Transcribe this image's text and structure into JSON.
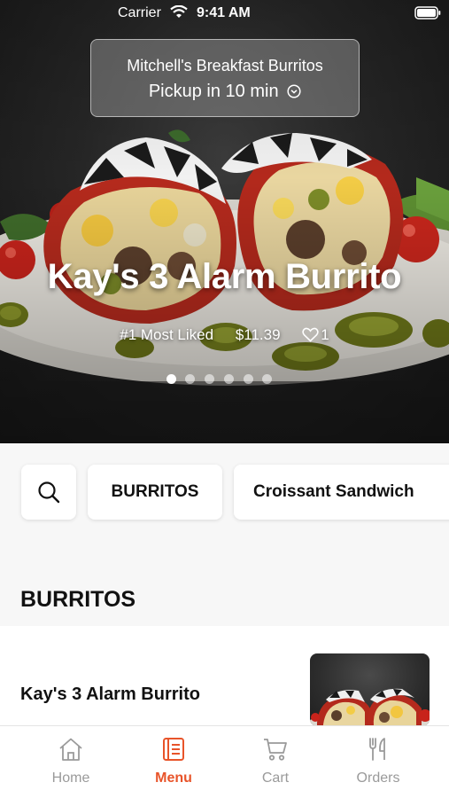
{
  "status_bar": {
    "carrier": "Carrier",
    "time": "9:41 AM"
  },
  "pickup": {
    "restaurant": "Mitchell's Breakfast Burritos",
    "time_label": "Pickup in 10 min"
  },
  "hero": {
    "title": "Kay's 3 Alarm Burrito",
    "rank": "#1 Most Liked",
    "price": "$11.39",
    "likes": "1",
    "carousel": {
      "count": 6,
      "active_index": 0
    }
  },
  "categories": {
    "search_icon": "search-icon",
    "items": [
      "BURRITOS",
      "Croissant Sandwich"
    ]
  },
  "section": {
    "title": "BURRITOS"
  },
  "menu_items": [
    {
      "name": "Kay's 3 Alarm Burrito"
    }
  ],
  "tab_bar": {
    "items": [
      {
        "label": "Home",
        "icon": "home-icon"
      },
      {
        "label": "Menu",
        "icon": "menu-icon"
      },
      {
        "label": "Cart",
        "icon": "cart-icon"
      },
      {
        "label": "Orders",
        "icon": "orders-icon"
      }
    ],
    "active": "Menu"
  },
  "colors": {
    "accent": "#e8542a",
    "tab_inactive": "#9a9a9a"
  }
}
